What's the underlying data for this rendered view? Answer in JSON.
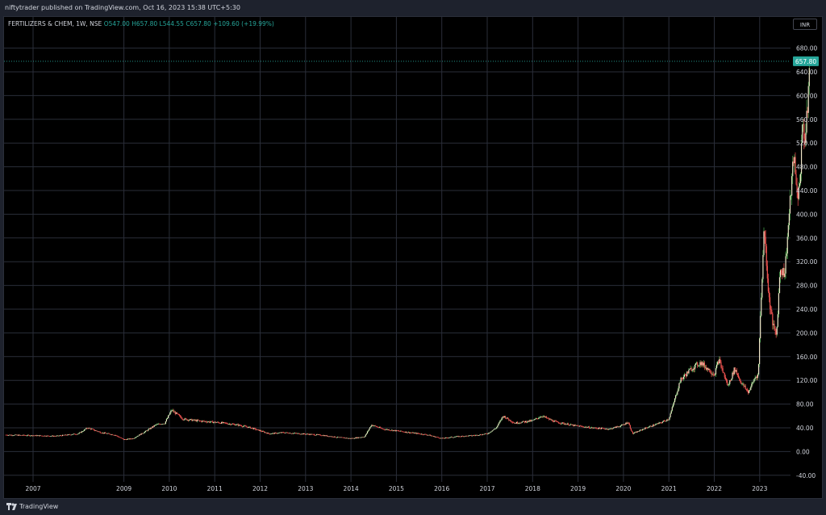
{
  "header": {
    "publisher_line": "niftytrader published on TradingView.com, Oct 16, 2023 15:38 UTC+5:30"
  },
  "legend": {
    "symbol": "FERTILIZERS & CHEM, 1W, NSE",
    "open": "O547.00",
    "high": "H657.80",
    "low": "L544.55",
    "close": "C657.80",
    "change": "+109.60 (+19.99%)"
  },
  "currency_label": "INR",
  "footer": {
    "brand": "TradingView"
  },
  "colors": {
    "up": "#26a69a",
    "down": "#ef5350",
    "wick_up": "#4caf50",
    "grid": "#2a2e39",
    "price_label": "#26a69a"
  },
  "chart_data": {
    "type": "candlestick",
    "x_tick_labels": [
      "2007",
      "2009",
      "2010",
      "2011",
      "2012",
      "2013",
      "2014",
      "2015",
      "2016",
      "2017",
      "2018",
      "2019",
      "2020",
      "2021",
      "2022",
      "2023"
    ],
    "y_tick_labels": [
      "680.00",
      "640.00",
      "600.00",
      "560.00",
      "520.00",
      "480.00",
      "440.00",
      "400.00",
      "360.00",
      "320.00",
      "280.00",
      "240.00",
      "200.00",
      "160.00",
      "120.00",
      "80.00",
      "40.00",
      "0.00",
      "-40.00"
    ],
    "ylim": [
      -40,
      680
    ],
    "last_price": "657.80",
    "last_price_value": 657.8,
    "grid": true,
    "series": [
      {
        "points": [
          [
            2006.4,
            28
          ],
          [
            2007.0,
            27
          ],
          [
            2007.5,
            26
          ],
          [
            2008.0,
            30
          ],
          [
            2008.2,
            40
          ],
          [
            2008.5,
            32
          ],
          [
            2008.8,
            28
          ],
          [
            2009.0,
            20
          ],
          [
            2009.2,
            22
          ],
          [
            2009.5,
            35
          ],
          [
            2009.7,
            45
          ],
          [
            2009.9,
            48
          ],
          [
            2010.05,
            70
          ],
          [
            2010.3,
            55
          ],
          [
            2010.6,
            52
          ],
          [
            2010.9,
            50
          ],
          [
            2011.2,
            48
          ],
          [
            2011.5,
            45
          ],
          [
            2011.8,
            40
          ],
          [
            2012.0,
            35
          ],
          [
            2012.2,
            30
          ],
          [
            2012.5,
            32
          ],
          [
            2012.9,
            30
          ],
          [
            2013.3,
            28
          ],
          [
            2013.7,
            24
          ],
          [
            2014.0,
            22
          ],
          [
            2014.3,
            25
          ],
          [
            2014.45,
            45
          ],
          [
            2014.7,
            38
          ],
          [
            2015.0,
            35
          ],
          [
            2015.3,
            32
          ],
          [
            2015.7,
            28
          ],
          [
            2016.0,
            22
          ],
          [
            2016.3,
            25
          ],
          [
            2016.7,
            27
          ],
          [
            2017.0,
            30
          ],
          [
            2017.2,
            40
          ],
          [
            2017.35,
            60
          ],
          [
            2017.6,
            48
          ],
          [
            2018.0,
            52
          ],
          [
            2018.2,
            60
          ],
          [
            2018.5,
            50
          ],
          [
            2018.9,
            44
          ],
          [
            2019.3,
            40
          ],
          [
            2019.7,
            38
          ],
          [
            2020.0,
            45
          ],
          [
            2020.1,
            50
          ],
          [
            2020.2,
            30
          ],
          [
            2020.5,
            40
          ],
          [
            2020.8,
            48
          ],
          [
            2021.0,
            55
          ],
          [
            2021.1,
            80
          ],
          [
            2021.25,
            120
          ],
          [
            2021.5,
            140
          ],
          [
            2021.7,
            150
          ],
          [
            2022.0,
            130
          ],
          [
            2022.1,
            155
          ],
          [
            2022.3,
            110
          ],
          [
            2022.45,
            140
          ],
          [
            2022.6,
            115
          ],
          [
            2022.75,
            100
          ],
          [
            2022.9,
            125
          ],
          [
            2022.97,
            130
          ],
          [
            2023.0,
            200
          ],
          [
            2023.1,
            380
          ],
          [
            2023.2,
            260
          ],
          [
            2023.3,
            210
          ],
          [
            2023.37,
            195
          ],
          [
            2023.45,
            310
          ],
          [
            2023.55,
            300
          ],
          [
            2023.6,
            350
          ],
          [
            2023.65,
            400
          ],
          [
            2023.75,
            500
          ],
          [
            2023.8,
            450
          ],
          [
            2023.85,
            430
          ],
          [
            2023.9,
            480
          ],
          [
            2023.95,
            560
          ],
          [
            2024.0,
            520
          ],
          [
            2024.05,
            575
          ],
          [
            2024.1,
            657.8
          ]
        ]
      }
    ]
  }
}
